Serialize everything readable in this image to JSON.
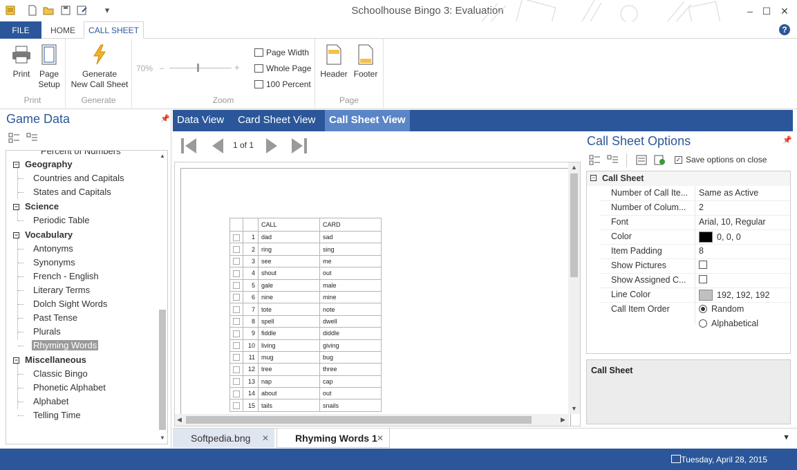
{
  "window": {
    "title": "Schoolhouse Bingo 3: Evaluation",
    "minimize": "–",
    "maximize": "☐",
    "close": "✕"
  },
  "ribbon": {
    "tabs": [
      "FILE",
      "HOME",
      "CALL SHEET"
    ],
    "active_tab": "CALL SHEET",
    "help": "?",
    "groups": {
      "print": {
        "label": "Print",
        "print_btn": "Print",
        "page_setup_btn": "Page\nSetup"
      },
      "generate": {
        "label": "Generate",
        "generate_btn": "Generate\nNew Call Sheet"
      },
      "zoom": {
        "label": "Zoom",
        "zoom_value": "70%",
        "page_width": "Page Width",
        "whole_page": "Whole Page",
        "hundred_percent": "100 Percent",
        "zoom_fraction": 0.45
      },
      "page": {
        "label": "Page",
        "header_btn": "Header",
        "footer_btn": "Footer"
      }
    }
  },
  "left_panel": {
    "title": "Game Data",
    "tree": {
      "partial_top": "Percent of Numbers",
      "categories": [
        {
          "name": "Geography",
          "items": [
            "Countries and Capitals",
            "States and Capitals"
          ]
        },
        {
          "name": "Science",
          "items": [
            "Periodic Table"
          ]
        },
        {
          "name": "Vocabulary",
          "items": [
            "Antonyms",
            "Synonyms",
            "French - English",
            "Literary Terms",
            "Dolch Sight Words",
            "Past Tense",
            "Plurals",
            "Rhyming Words"
          ]
        },
        {
          "name": "Miscellaneous",
          "items": [
            "Classic Bingo",
            "Phonetic Alphabet",
            "Alphabet",
            "Telling Time"
          ]
        }
      ],
      "selected": "Rhyming Words"
    }
  },
  "view_tabs": [
    "Data View",
    "Card Sheet View",
    "Call Sheet View"
  ],
  "active_view": "Call Sheet View",
  "nav": {
    "page_indicator": "1 of 1"
  },
  "call_sheet": {
    "headers": [
      "CALL",
      "CARD"
    ],
    "rows": [
      [
        "1",
        "dad",
        "sad"
      ],
      [
        "2",
        "ring",
        "sing"
      ],
      [
        "3",
        "see",
        "me"
      ],
      [
        "4",
        "shout",
        "out"
      ],
      [
        "5",
        "gale",
        "male"
      ],
      [
        "6",
        "nine",
        "mine"
      ],
      [
        "7",
        "tote",
        "note"
      ],
      [
        "8",
        "spell",
        "dwell"
      ],
      [
        "9",
        "fiddle",
        "diddle"
      ],
      [
        "10",
        "living",
        "giving"
      ],
      [
        "11",
        "mug",
        "bug"
      ],
      [
        "12",
        "tree",
        "three"
      ],
      [
        "13",
        "nap",
        "cap"
      ],
      [
        "14",
        "about",
        "out"
      ],
      [
        "15",
        "tails",
        "snails"
      ]
    ]
  },
  "right_panel": {
    "title": "Call Sheet Options",
    "save_on_close": "Save options on close",
    "section": "Call Sheet",
    "properties": [
      {
        "name": "Number of Call Ite...",
        "value": "Same as Active"
      },
      {
        "name": "Number of Colum...",
        "value": "2"
      },
      {
        "name": "Font",
        "value": "Arial, 10, Regular"
      },
      {
        "name": "Color",
        "value": "0, 0, 0",
        "swatch": "#000000"
      },
      {
        "name": "Item Padding",
        "value": "8"
      },
      {
        "name": "Show Pictures",
        "value": ""
      },
      {
        "name": "Show Assigned C...",
        "value": ""
      },
      {
        "name": "Line Color",
        "value": "192, 192, 192",
        "swatch": "#c0c0c0"
      },
      {
        "name": "Call Item Order",
        "value": "Random"
      }
    ],
    "order_options": [
      "Random",
      "Alphabetical"
    ],
    "description_title": "Call Sheet"
  },
  "doc_tabs": [
    {
      "label": "Softpedia.bng",
      "active": false
    },
    {
      "label": "Rhyming Words 1",
      "active": true
    }
  ],
  "status": {
    "date": "Tuesday, April 28, 2015"
  },
  "colors": {
    "accent": "#2b579a",
    "tab_active": "#5a86c8",
    "status": "#2b579a"
  }
}
